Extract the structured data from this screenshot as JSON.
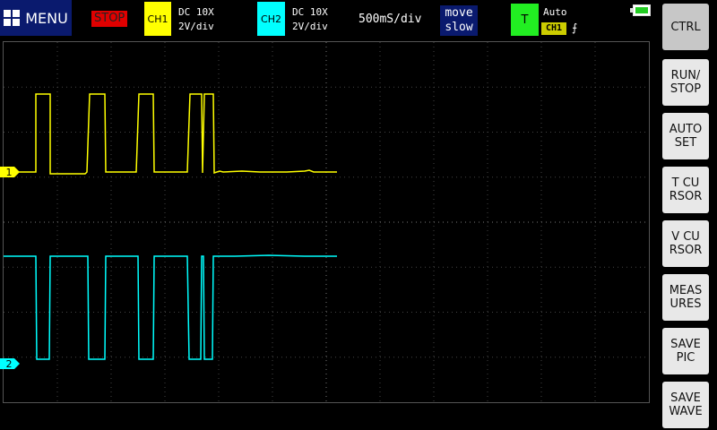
{
  "header": {
    "menu_label": "MENU",
    "run_state": "STOP",
    "ch1": {
      "badge": "CH1",
      "coupling": "DC 10X",
      "scale": "2V/div",
      "color": "#ffff00"
    },
    "ch2": {
      "badge": "CH2",
      "coupling": "DC 10X",
      "scale": "2V/div",
      "color": "#00ffff"
    },
    "timebase": "500mS/div",
    "move_line1": "move",
    "move_line2": "slow",
    "trigger": {
      "badge": "T",
      "mode": "Auto",
      "source": "CH1",
      "edge": "⨍"
    }
  },
  "scope": {
    "ch1_marker": "1",
    "ch2_marker": "2"
  },
  "side_buttons": [
    {
      "label": "CTRL"
    },
    {
      "label": "RUN/\nSTOP"
    },
    {
      "label": "AUTO\nSET"
    },
    {
      "label": "T CU\nRSOR"
    },
    {
      "label": "V CU\nRSOR"
    },
    {
      "label": "MEAS\nURES"
    },
    {
      "label": "SAVE\nPIC"
    },
    {
      "label": "SAVE\nWAVE"
    }
  ]
}
